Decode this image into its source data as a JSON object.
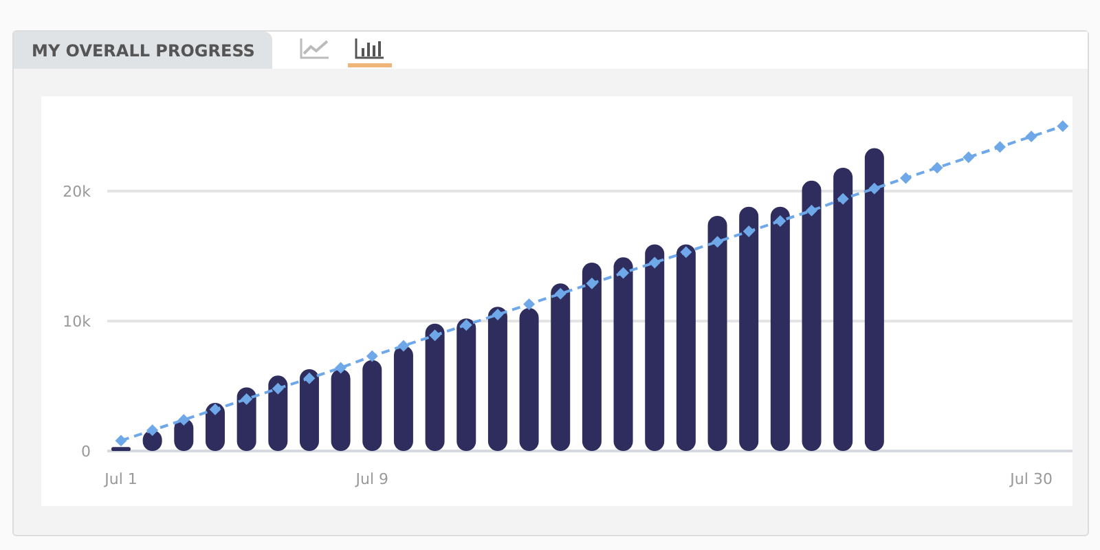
{
  "panel": {
    "title": "MY OVERALL PROGRESS"
  },
  "view_toggles": [
    {
      "kind": "line",
      "selected": false
    },
    {
      "kind": "bar",
      "selected": true
    }
  ],
  "chart_data": {
    "type": "bar",
    "categories": [
      "Jul 1",
      null,
      null,
      null,
      null,
      null,
      null,
      null,
      "Jul 9",
      null,
      null,
      null,
      null,
      null,
      null,
      null,
      null,
      null,
      null,
      null,
      null,
      null,
      null,
      null,
      null,
      null,
      null,
      null,
      null,
      "Jul 30",
      null
    ],
    "series": [
      {
        "type": "bar",
        "color": "#2e2d5e",
        "values": [
          300,
          1600,
          2500,
          3700,
          4900,
          5800,
          6300,
          6300,
          7000,
          8100,
          9800,
          10200,
          11100,
          11000,
          12900,
          14500,
          14900,
          15900,
          15900,
          18100,
          18800,
          18800,
          20800,
          21800,
          23300,
          null,
          null,
          null,
          null,
          null,
          null
        ]
      },
      {
        "type": "line",
        "line_style": "dashed",
        "marker": "diamond",
        "color": "#6fa8e8",
        "values": [
          800,
          1600,
          2400,
          3200,
          4000,
          4800,
          5600,
          6400,
          7300,
          8100,
          8900,
          9700,
          10500,
          11300,
          12100,
          12900,
          13700,
          14500,
          15300,
          16100,
          16900,
          17700,
          18500,
          19400,
          20200,
          21000,
          21800,
          22600,
          23400,
          24200,
          25000
        ]
      }
    ],
    "ylim": [
      0,
      27300
    ],
    "yticks": [
      {
        "value": 0,
        "label": "0"
      },
      {
        "value": 10000,
        "label": "10k"
      },
      {
        "value": 20000,
        "label": "20k"
      }
    ]
  }
}
